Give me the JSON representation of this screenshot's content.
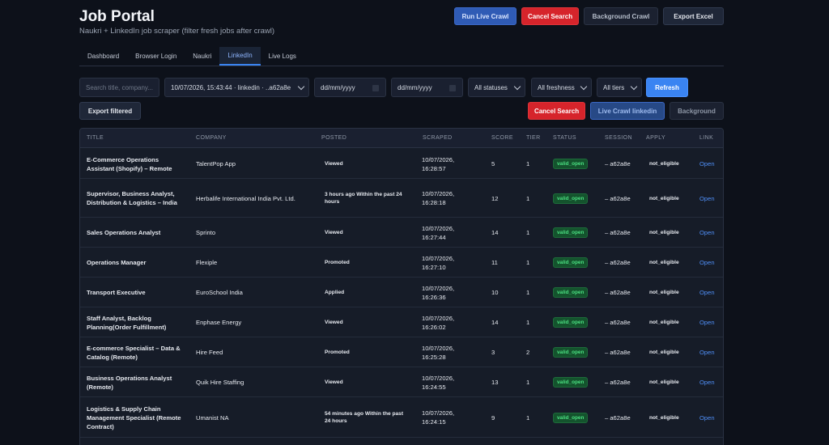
{
  "header": {
    "title": "Job Portal",
    "subtitle": "Naukri + LinkedIn job scraper (filter fresh jobs after crawl)",
    "buttons": {
      "run_live_crawl": "Run Live Crawl",
      "cancel_search": "Cancel Search",
      "background_crawl": "Background Crawl",
      "export_excel": "Export Excel"
    }
  },
  "tabs": [
    "Dashboard",
    "Browser Login",
    "Naukri",
    "LinkedIn",
    "Live Logs"
  ],
  "active_tab": "LinkedIn",
  "filters": {
    "search_placeholder": "Search title, company...",
    "session_value": "10/07/2026, 15:43:44 · linkedin · ..a62a8e",
    "date_from_placeholder": "dd/mm/yyyy",
    "date_to_placeholder": "dd/mm/yyyy",
    "status_value": "All statuses",
    "freshness_value": "All freshness",
    "tier_value": "All tiers",
    "refresh": "Refresh"
  },
  "actions": {
    "export_filtered": "Export filtered",
    "cancel_search": "Cancel Search",
    "live_crawl_linkedin": "Live Crawl linkedin",
    "background": "Background"
  },
  "table": {
    "columns": {
      "title": "TITLE",
      "company": "COMPANY",
      "posted": "POSTED",
      "scraped": "SCRAPED",
      "score": "SCORE",
      "tier": "TIER",
      "status": "STATUS",
      "session": "SESSION",
      "apply": "APPLY",
      "link": "LINK"
    },
    "rows": [
      {
        "title": "E-Commerce Operations Assistant (Shopify) – Remote",
        "company": "TalentPop App",
        "posted": "Viewed",
        "scraped": "10/07/2026, 16:28:57",
        "score": "5",
        "tier": "1",
        "status": "valid_open",
        "session": "– a62a8e",
        "apply": "not_eligible",
        "link": "Open"
      },
      {
        "title": "Supervisor, Business Analyst, Distribution & Logistics – India",
        "company": "Herbalife International India Pvt. Ltd.",
        "posted": "3 hours ago Within the past 24 hours",
        "scraped": "10/07/2026, 16:28:18",
        "score": "12",
        "tier": "1",
        "status": "valid_open",
        "session": "– a62a8e",
        "apply": "not_eligible",
        "link": "Open"
      },
      {
        "title": "Sales Operations Analyst",
        "company": "Sprinto",
        "posted": "Viewed",
        "scraped": "10/07/2026, 16:27:44",
        "score": "14",
        "tier": "1",
        "status": "valid_open",
        "session": "– a62a8e",
        "apply": "not_eligible",
        "link": "Open"
      },
      {
        "title": "Operations Manager",
        "company": "Flexiple",
        "posted": "Promoted",
        "scraped": "10/07/2026, 16:27:10",
        "score": "11",
        "tier": "1",
        "status": "valid_open",
        "session": "– a62a8e",
        "apply": "not_eligible",
        "link": "Open"
      },
      {
        "title": "Transport Executive",
        "company": "EuroSchool India",
        "posted": "Applied",
        "scraped": "10/07/2026, 16:26:36",
        "score": "10",
        "tier": "1",
        "status": "valid_open",
        "session": "– a62a8e",
        "apply": "not_eligible",
        "link": "Open"
      },
      {
        "title": "Staff Analyst, Backlog Planning(Order Fulfillment)",
        "company": "Enphase Energy",
        "posted": "Viewed",
        "scraped": "10/07/2026, 16:26:02",
        "score": "14",
        "tier": "1",
        "status": "valid_open",
        "session": "– a62a8e",
        "apply": "not_eligible",
        "link": "Open"
      },
      {
        "title": "E-commerce Specialist – Data & Catalog (Remote)",
        "company": "Hire Feed",
        "posted": "Promoted",
        "scraped": "10/07/2026, 16:25:28",
        "score": "3",
        "tier": "2",
        "status": "valid_open",
        "session": "– a62a8e",
        "apply": "not_eligible",
        "link": "Open"
      },
      {
        "title": "Business Operations Analyst (Remote)",
        "company": "Quik Hire Staffing",
        "posted": "Viewed",
        "scraped": "10/07/2026, 16:24:55",
        "score": "13",
        "tier": "1",
        "status": "valid_open",
        "session": "– a62a8e",
        "apply": "not_eligible",
        "link": "Open"
      },
      {
        "title": "Logistics & Supply Chain Management Specialist (Remote Contract)",
        "company": "Umanist NA",
        "posted": "54 minutes ago Within the past 24 hours",
        "scraped": "10/07/2026, 16:24:15",
        "score": "9",
        "tier": "1",
        "status": "valid_open",
        "session": "– a62a8e",
        "apply": "not_eligible",
        "link": "Open"
      }
    ]
  }
}
